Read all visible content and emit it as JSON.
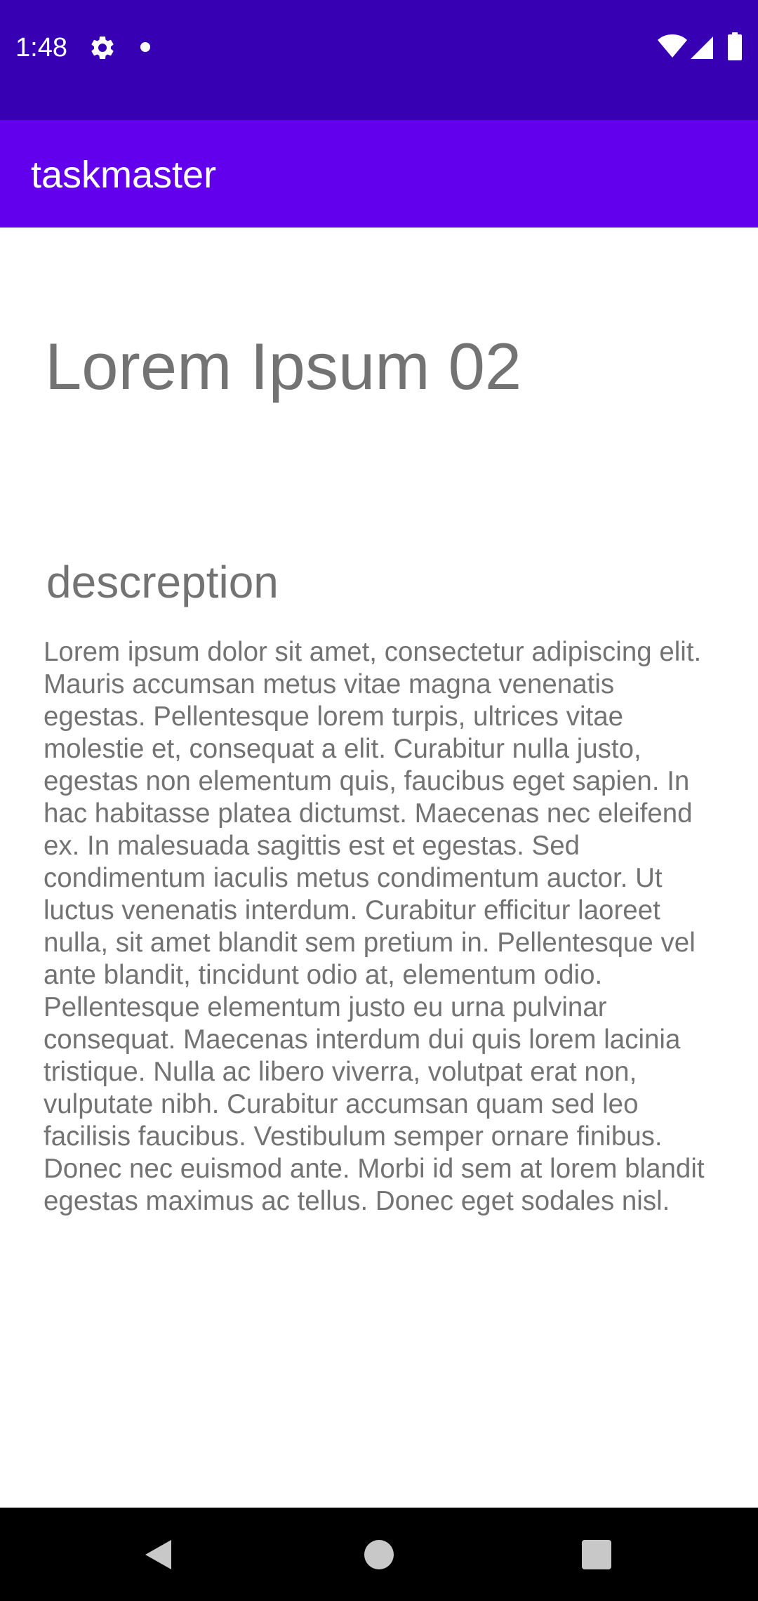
{
  "status_bar": {
    "time": "1:48",
    "icons": [
      "gear-icon",
      "notification-dot-icon",
      "wifi-icon",
      "signal-icon",
      "battery-icon"
    ],
    "background": "#3700b3"
  },
  "app_bar": {
    "title": "taskmaster",
    "background": "#6200ee"
  },
  "task": {
    "title": "Lorem Ipsum 02",
    "description_label": "descreption",
    "description": "Lorem ipsum dolor sit amet, consectetur adipiscing elit. Mauris accumsan metus vitae magna venenatis egestas. Pellentesque lorem turpis, ultrices vitae molestie et, consequat a elit. Curabitur nulla justo, egestas non elementum quis, faucibus eget sapien. In hac habitasse platea dictumst. Maecenas nec eleifend ex. In malesuada sagittis est et egestas. Sed condimentum iaculis metus condimentum auctor. Ut luctus venenatis interdum. Curabitur efficitur laoreet nulla, sit amet blandit sem pretium in. Pellentesque vel ante blandit, tincidunt odio at, elementum odio. Pellentesque elementum justo eu urna pulvinar consequat. Maecenas interdum dui quis lorem lacinia tristique. Nulla ac libero viverra, volutpat erat non, vulputate nibh. Curabitur accumsan quam sed leo facilisis faucibus. Vestibulum semper ornare finibus. Donec nec euismod ante. Morbi id sem at lorem blandit egestas maximus ac tellus. Donec eget sodales nisl.",
    "text_color": "#737373"
  },
  "nav_bar": {
    "icons": [
      "back-icon",
      "home-icon",
      "recents-icon"
    ],
    "background": "#000000"
  }
}
